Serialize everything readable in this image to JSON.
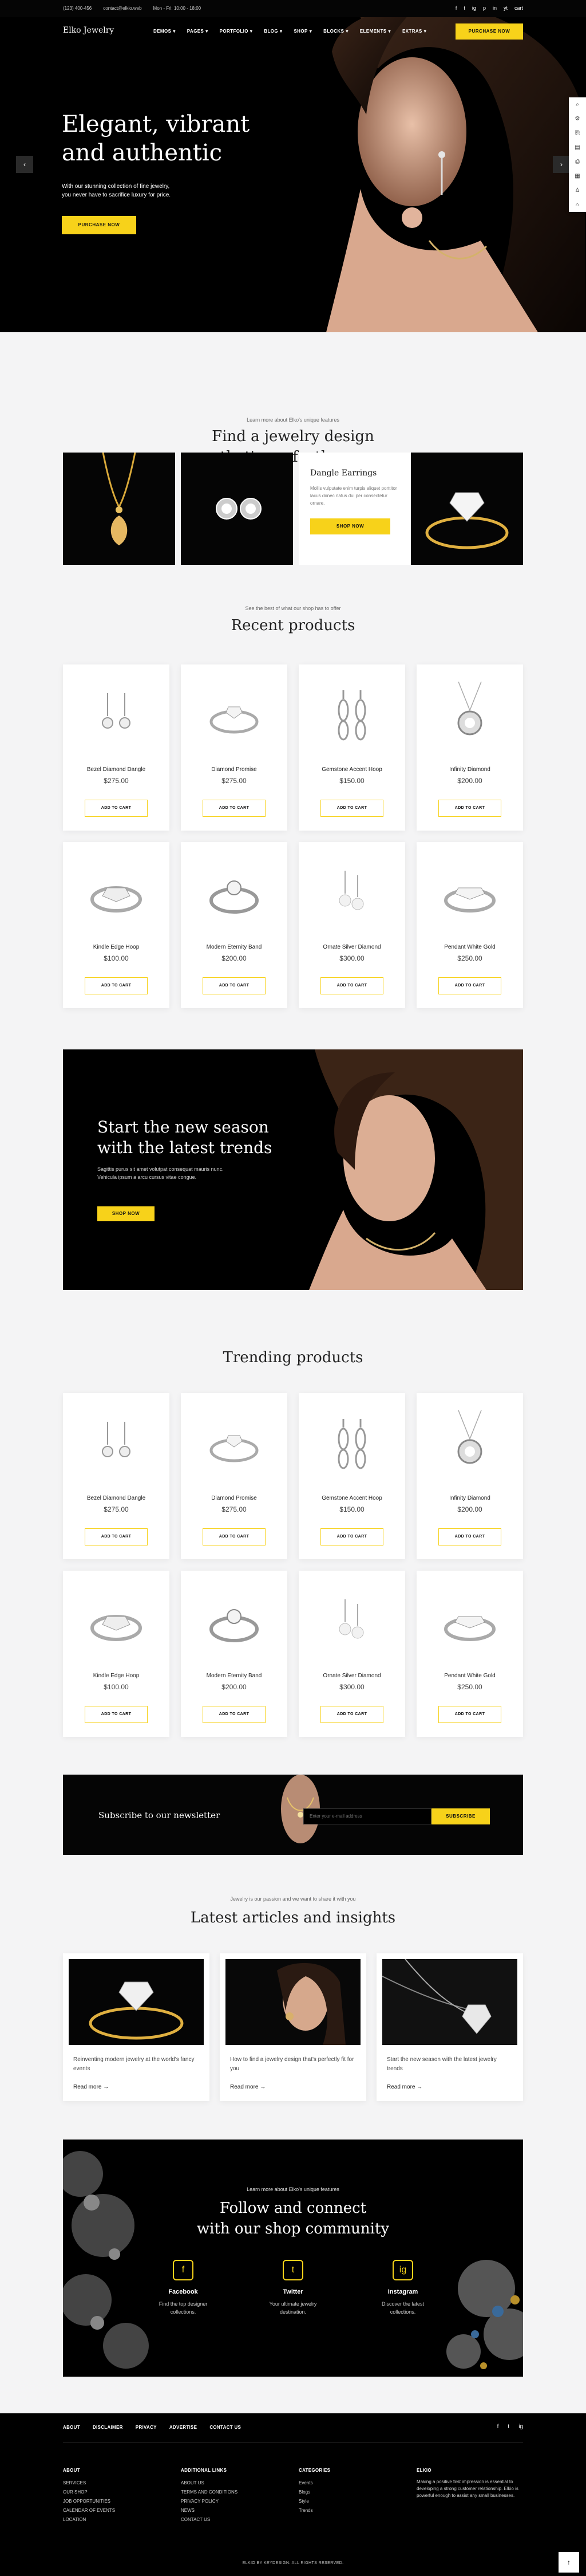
{
  "topbar": {
    "phone": "(123) 400-456",
    "email": "contact@elkio.web",
    "hours": "Mon - Fri: 10:00 - 18:00",
    "social": [
      "f",
      "t",
      "ig",
      "p",
      "in",
      "yt",
      "cart"
    ]
  },
  "header": {
    "logo": "Elko Jewelry",
    "nav": [
      "DEMOS",
      "PAGES",
      "PORTFOLIO",
      "BLOG",
      "SHOP",
      "BLOCKS",
      "ELEMENTS",
      "EXTRAS"
    ],
    "cta": "PURCHASE NOW"
  },
  "hero": {
    "title_line1": "Elegant, vibrant",
    "title_line2": "and authentic",
    "subtitle_line1": "With our stunning collection of fine jewelry,",
    "subtitle_line2": "you never have to sacrifice luxury for price.",
    "button": "PURCHASE NOW",
    "prev": "‹",
    "next": "›"
  },
  "side_tools": [
    "⌕",
    "⚙",
    "⎘",
    "▤",
    "⎙",
    "▦",
    "♙",
    "⌂"
  ],
  "features": {
    "kicker": "Learn more about Elko's unique features",
    "title_line1": "Find a jewelry design",
    "title_line2": "that's perfectly you",
    "card_title": "Dangle Earrings",
    "card_text": "Mollis vulputate enim turpis aliquet porttitor lacus donec natus dui per consectetur ornare.",
    "card_button": "SHOP NOW"
  },
  "recent": {
    "kicker": "See the best of what our shop has to offer",
    "title": "Recent products",
    "cart_label": "ADD TO CART",
    "products": [
      {
        "name": "Bezel Diamond Dangle",
        "price": "$275.00"
      },
      {
        "name": "Diamond Promise",
        "price": "$275.00"
      },
      {
        "name": "Gemstone Accent Hoop",
        "price": "$150.00"
      },
      {
        "name": "Infinity Diamond",
        "price": "$200.00"
      },
      {
        "name": "Kindle Edge Hoop",
        "price": "$100.00"
      },
      {
        "name": "Modern Eternity Band",
        "price": "$200.00"
      },
      {
        "name": "Ornate Silver Diamond",
        "price": "$300.00"
      },
      {
        "name": "Pendant White Gold",
        "price": "$250.00"
      }
    ]
  },
  "promo": {
    "title_line1": "Start the new season",
    "title_line2": "with the latest trends",
    "text_line1": "Sagittis purus sit amet volutpat consequat mauris nunc.",
    "text_line2": "Vehicula ipsum a arcu cursus vitae congue.",
    "button": "SHOP NOW"
  },
  "trending": {
    "title": "Trending products",
    "cart_label": "ADD TO CART",
    "products": [
      {
        "name": "Bezel Diamond Dangle",
        "price": "$275.00"
      },
      {
        "name": "Diamond Promise",
        "price": "$275.00"
      },
      {
        "name": "Gemstone Accent Hoop",
        "price": "$150.00"
      },
      {
        "name": "Infinity Diamond",
        "price": "$200.00"
      },
      {
        "name": "Kindle Edge Hoop",
        "price": "$100.00"
      },
      {
        "name": "Modern Eternity Band",
        "price": "$200.00"
      },
      {
        "name": "Ornate Silver Diamond",
        "price": "$300.00"
      },
      {
        "name": "Pendant White Gold",
        "price": "$250.00"
      }
    ]
  },
  "newsletter": {
    "title": "Subscribe to our newsletter",
    "placeholder": "Enter your e-mail address",
    "button": "SUBSCRIBE"
  },
  "blog": {
    "kicker": "Jewelry is our passion and we want to share it with you",
    "title": "Latest articles and insights",
    "read_more": "Read more →",
    "posts": [
      {
        "title": "Reinventing modern jewelry at the world's fancy events"
      },
      {
        "title": "How to find a jewelry design that's perfectly fit for you"
      },
      {
        "title": "Start the new season with the latest jewelry trends"
      }
    ]
  },
  "community": {
    "kicker": "Learn more about Elko's unique features",
    "title_line1": "Follow and connect",
    "title_line2": "with our shop community",
    "columns": [
      {
        "icon": "f",
        "title": "Facebook",
        "text_line1": "Find the top designer",
        "text_line2": "collections."
      },
      {
        "icon": "t",
        "title": "Twitter",
        "text_line1": "Your ultimate jewelry",
        "text_line2": "destination."
      },
      {
        "icon": "ig",
        "title": "Instagram",
        "text_line1": "Discover the latest",
        "text_line2": "collections."
      }
    ]
  },
  "footer": {
    "links": [
      "ABOUT",
      "DISCLAIMER",
      "PRIVACY",
      "ADVERTISE",
      "CONTACT US"
    ],
    "social": [
      "f",
      "t",
      "ig"
    ],
    "col1": {
      "title": "ABOUT",
      "items": [
        "SERVICES",
        "OUR SHOP",
        "JOB OPPORTUNITIES",
        "CALENDAR OF EVENTS",
        "LOCATION"
      ]
    },
    "col2": {
      "title": "ADDITIONAL LINKS",
      "items": [
        "ABOUT US",
        "TERMS AND CONDITIONS",
        "PRIVACY POLICY",
        "NEWS",
        "CONTACT US"
      ]
    },
    "col3": {
      "title": "CATEGORIES",
      "items": [
        "Events",
        "Blogs",
        "Style",
        "Trends"
      ]
    },
    "col4": {
      "title": "ELKIO",
      "text": "Making a positive first impression is essential to developing a strong customer relationship. Elkio is powerful enough to assist any small businesses."
    },
    "copyright": "ELKIO BY KEYDESIGN. ALL RIGHTS RESERVED.",
    "to_top": "↑"
  },
  "colors": {
    "accent": "#f7d21a",
    "dark": "#000000",
    "light_bg": "#f4f4f5"
  }
}
